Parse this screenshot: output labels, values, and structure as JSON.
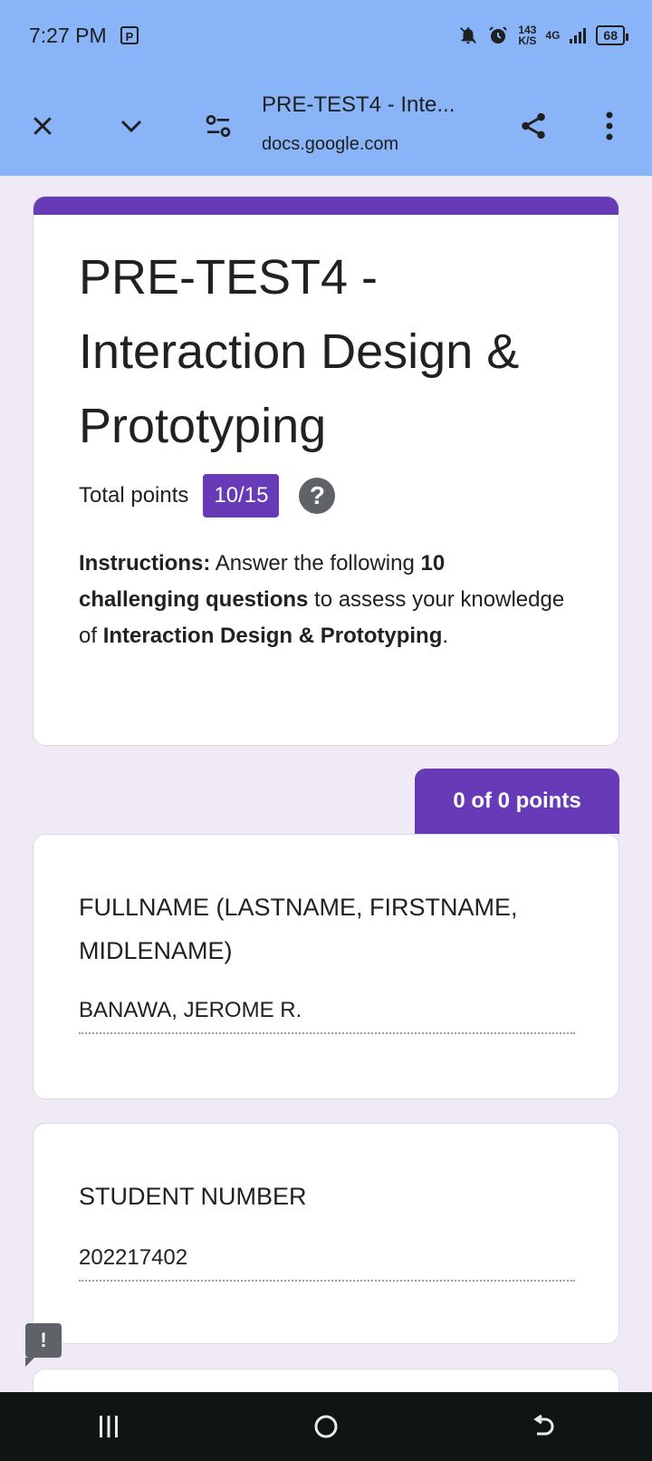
{
  "status": {
    "time": "7:27 PM",
    "net_speed_value": "143",
    "net_speed_unit": "K/S",
    "network": "4G",
    "battery": "68"
  },
  "browser": {
    "title": "PRE-TEST4 - Inte...",
    "url": "docs.google.com"
  },
  "form": {
    "title": "PRE-TEST4 - Interaction Design & Prototyping",
    "total_points_label": "Total points",
    "total_points_value": "10/15",
    "instructions": {
      "prefix": "Instructions:",
      "text1": " Answer the following ",
      "count": "10",
      "strong1": "challenging questions",
      "text2": " to assess your knowledge of ",
      "strong2": "Interaction Design & Prototyping",
      "end": "."
    },
    "section_score": "0 of 0 points",
    "questions": [
      {
        "label": "FULLNAME (LASTNAME, FIRSTNAME, MIDLENAME)",
        "answer": "BANAWA, JEROME R."
      },
      {
        "label": "STUDENT NUMBER",
        "answer": "202217402"
      }
    ]
  },
  "colors": {
    "accent": "#673ab7",
    "toolbar": "#8ab4f8",
    "page_bg": "#efeaf6"
  }
}
